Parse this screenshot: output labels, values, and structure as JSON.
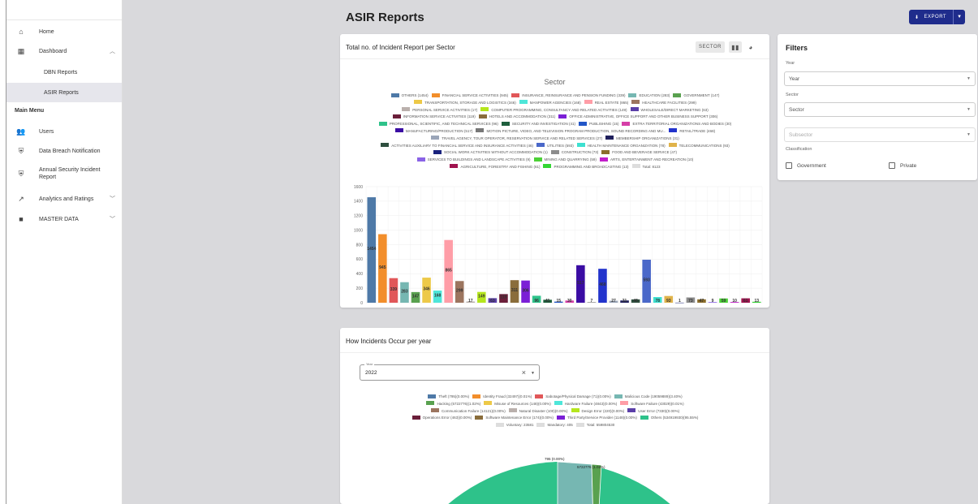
{
  "sidebar": {
    "home": "Home",
    "dashboard": "Dashboard",
    "dbn": "DBN Reports",
    "asir": "ASIR Reports",
    "main_menu": "Main Menu",
    "users": "Users",
    "breach": "Data Breach Notification",
    "annual": "Annual Security Incident Report",
    "analytics": "Analytics and Ratings",
    "master": "MASTER DATA"
  },
  "page": {
    "title": "ASIR Reports",
    "export": "EXPORT"
  },
  "colors": {
    "accent": "#1f2c8c",
    "active_nav": "#e6e6ec"
  },
  "sector_card": {
    "title": "Total no. of Incident Report per Sector",
    "sector_btn": "SECTOR",
    "chart_data": {
      "type": "bar",
      "title": "Sector",
      "ylim": [
        0,
        1600
      ],
      "yticks": [
        0,
        200,
        400,
        600,
        800,
        1000,
        1200,
        1400,
        1600
      ],
      "legend_total": "Total: 8123",
      "series": [
        {
          "name": "OTHERS",
          "value": 1454,
          "color": "#4e79a7"
        },
        {
          "name": "FINANCIAL SERVICE ACTIVITIES",
          "value": 945,
          "color": "#f28e2b"
        },
        {
          "name": "INSURANCE, REINSURANCE AND PENSION FUNDING",
          "value": 339,
          "color": "#e15759"
        },
        {
          "name": "EDUCATION",
          "value": 283,
          "color": "#76b7b2"
        },
        {
          "name": "GOVERNMENT",
          "value": 147,
          "color": "#59a14f"
        },
        {
          "name": "TRANSPORTATION, STORAGE AND LOGISTICS",
          "value": 346,
          "color": "#edc948"
        },
        {
          "name": "MANPOWER AGENCIES",
          "value": 168,
          "color": "#4ee6d9"
        },
        {
          "name": "REAL ESTATE",
          "value": 865,
          "color": "#ff9da7"
        },
        {
          "name": "HEALTHCARE FACILITIES",
          "value": 299,
          "color": "#9c755f"
        },
        {
          "name": "PERSONAL SERVICE ACTIVITIES",
          "value": 17,
          "color": "#bab0ac"
        },
        {
          "name": "COMPUTER PROGRAMMING, CONSULTANCY AND RELATED ACTIVITIES",
          "value": 149,
          "color": "#b5e61d"
        },
        {
          "name": "MANPOWER AGENCIES",
          "value": 63,
          "color": "#5b3fa8"
        },
        {
          "name": "INFORMATION SERVICE ACTIVITIES",
          "value": 119,
          "color": "#6b1f3a"
        },
        {
          "name": "HOTELS AND ACCOMMODATION",
          "value": 311,
          "color": "#8a6d3b"
        },
        {
          "name": "OFFICE ADMINISTRATIVE, OFFICE SUPPORT AND OTHER BUSINESS SUPPORT",
          "value": 306,
          "color": "#7b1fd6"
        },
        {
          "name": "PROFESSIONAL, SCIENTIFIC, AND TECHNICAL SERVICES",
          "value": 96,
          "color": "#2ec28a"
        },
        {
          "name": "SECURITY AND INVESTIGATION",
          "value": 41,
          "color": "#1d5e3c"
        },
        {
          "name": "PUBLISHING",
          "value": 15,
          "color": "#2356c7"
        },
        {
          "name": "EXTRA TERRITORIAL ORGANIZATIONS AND BODIES",
          "value": 30,
          "color": "#d63fa8"
        },
        {
          "name": "MANUFACTURING/PRODUCTION",
          "value": 517,
          "color": "#3a0ca3"
        },
        {
          "name": "MOTION PICTURE, VIDEO, AND TELEVISION PROGRAM PRODUCTION, SOUND RECORDING AND MU...",
          "value": 7,
          "color": "#777777"
        },
        {
          "name": "RETAIL/TRADE",
          "value": 468,
          "color": "#2233cc"
        },
        {
          "name": "TRAVEL AGENCY, TOUR OPERATOR, RESERVATION SERVICE AND RELATED SERVICES",
          "value": 27,
          "color": "#9aa5b8"
        },
        {
          "name": "MEMBERSHIP ORGANIZATIONS",
          "value": 31,
          "color": "#1f1f5c"
        },
        {
          "name": "ACTIVITIES AUXILIARY TO FINANCIAL SERVICE AND INSURANCE ACTIVITIES",
          "value": 46,
          "color": "#2f4f3f"
        },
        {
          "name": "UTILITIES",
          "value": 593,
          "color": "#4a68c9"
        },
        {
          "name": "HEALTH MAINTENANCE ORGANIZATION",
          "value": 78,
          "color": "#3de0d0"
        },
        {
          "name": "TELECOMMUNICATIONS",
          "value": 93,
          "color": "#e0b34a"
        },
        {
          "name": "SOCIAL WORK ACTIVITIES WITHOUT ACCOMMODATION",
          "value": 1,
          "color": "#1a237e"
        },
        {
          "name": "CONSTRUCTION",
          "value": 73,
          "color": "#8c8c8c"
        },
        {
          "name": "FOOD AND BEVERAGE SERVICE",
          "value": 47,
          "color": "#8b6d2b"
        },
        {
          "name": "SERVICES TO BUILDINGS AND LANDSCAPE ACTIVITIES",
          "value": 9,
          "color": "#8a63e6"
        },
        {
          "name": "MINING AND QUARRYING",
          "value": 59,
          "color": "#4cd137"
        },
        {
          "name": "ARTS, ENTERTAINMENT AND RECREATION",
          "value": 10,
          "color": "#c21ec9"
        },
        {
          "name": "AGRICULTURE, FORESTRY AND FISHING",
          "value": 61,
          "color": "#a0144f"
        },
        {
          "name": "PROGRAMMING AND BROADCASTING",
          "value": 13,
          "color": "#33d633"
        }
      ]
    }
  },
  "legend_rows": [
    [
      [
        "OTHERS (1454)",
        "#4e79a7"
      ],
      [
        "FINANCIAL SERVICE ACTIVITIES (945)",
        "#f28e2b"
      ],
      [
        "INSURANCE, REINSURANCE AND PENSION FUNDING (339)",
        "#e15759"
      ],
      [
        "EDUCATION (283)",
        "#76b7b2"
      ],
      [
        "GOVERNMENT (147)",
        "#59a14f"
      ]
    ],
    [
      [
        "TRANSPORTATION, STORAGE AND LOGISTICS (346)",
        "#edc948"
      ],
      [
        "MANPOWER AGENCIES (168)",
        "#4ee6d9"
      ],
      [
        "REAL ESTATE (865)",
        "#ff9da7"
      ],
      [
        "HEALTHCARE FACILITIES (299)",
        "#9c755f"
      ]
    ],
    [
      [
        "PERSONAL SERVICE ACTIVITIES (17)",
        "#bab0ac"
      ],
      [
        "COMPUTER PROGRAMMING, CONSULTANCY AND RELATED ACTIVITIES (149)",
        "#b5e61d"
      ],
      [
        "WHOLESALE/DIRECT MARKETING (63)",
        "#5b3fa8"
      ]
    ],
    [
      [
        "INFORMATION SERVICE ACTIVITIES (119)",
        "#6b1f3a"
      ],
      [
        "HOTELS AND ACCOMMODATION (311)",
        "#8a6d3b"
      ],
      [
        "OFFICE ADMINISTRATIVE, OFFICE SUPPORT AND OTHER BUSINESS SUPPORT (306)",
        "#7b1fd6"
      ]
    ],
    [
      [
        "PROFESSIONAL, SCIENTIFIC, AND TECHNICAL SERVICES (96)",
        "#2ec28a"
      ],
      [
        "SECURITY AND INVESTIGATION (41)",
        "#1d5e3c"
      ],
      [
        "PUBLISHING (15)",
        "#2356c7"
      ],
      [
        "EXTRA TERRITORIAL ORGANIZATIONS AND BODIES (30)",
        "#d63fa8"
      ]
    ],
    [
      [
        "MANUFACTURING/PRODUCTION (517)",
        "#3a0ca3"
      ],
      [
        "MOTION PICTURE, VIDEO, AND TELEVISION PROGRAM PRODUCTION, SOUND RECORDING AND MU...",
        "#777777"
      ],
      [
        "RETAIL/TRADE (468)",
        "#2233cc"
      ]
    ],
    [
      [
        "TRAVEL AGENCY, TOUR OPERATOR, RESERVATION SERVICE AND RELATED SERVICES (27)",
        "#9aa5b8"
      ],
      [
        "MEMBERSHIP ORGANIZATIONS (31)",
        "#1f1f5c"
      ]
    ],
    [
      [
        "ACTIVITIES AUXILIARY TO FINANCIAL SERVICE AND INSURANCE ACTIVITIES (46)",
        "#2f4f3f"
      ],
      [
        "UTILITIES (593)",
        "#4a68c9"
      ],
      [
        "HEALTH MAINTENANCE ORGANIZATION (78)",
        "#3de0d0"
      ],
      [
        "TELECOMMUNICATIONS (93)",
        "#e0b34a"
      ]
    ],
    [
      [
        "SOCIAL WORK ACTIVITIES WITHOUT ACCOMMODATION (1)",
        "#1a237e"
      ],
      [
        "CONSTRUCTION (73)",
        "#8c8c8c"
      ],
      [
        "FOOD AND BEVERAGE SERVICE (47)",
        "#8b6d2b"
      ]
    ],
    [
      [
        "SERVICES TO BUILDINGS AND LANDSCAPE ACTIVITIES (9)",
        "#8a63e6"
      ],
      [
        "MINING AND QUARRYING (59)",
        "#4cd137"
      ],
      [
        "ARTS, ENTERTAINMENT AND RECREATION (10)",
        "#c21ec9"
      ]
    ],
    [
      [
        "AGRICULTURE, FORESTRY AND FISHING (61)",
        "#a0144f"
      ],
      [
        "PROGRAMMING AND BROADCASTING (13)",
        "#33d633"
      ],
      [
        "Total: 8123",
        "#dddddd"
      ]
    ]
  ],
  "filters": {
    "title": "Filters",
    "year_label": "Year",
    "year_value": "Year",
    "sector_label": "Sector",
    "sector_value": "Sector",
    "subsector_value": "Subsector",
    "classification_label": "Classification",
    "government": "Government",
    "private": "Private"
  },
  "incidents_card": {
    "title": "How Incidents Occur per year",
    "year_field_label": "Year",
    "year_value": "2022",
    "legend_rows": [
      [
        [
          "Theft (795)(0.00%)",
          "#4e79a7"
        ],
        [
          "Identity Fraud (32497)(0.01%)",
          "#f28e2b"
        ],
        [
          "Sabotage/Physical Damage (71)(0.00%)",
          "#e15759"
        ],
        [
          "Malicious Code (19059889)(3.40%)",
          "#76b7b2"
        ]
      ],
      [
        [
          "Hacking (5722776)(1.02%)",
          "#59a14f"
        ],
        [
          "Misuse of Resources (148)(0.00%)",
          "#edc948"
        ],
        [
          "Hardware Failure (4843)(0.00%)",
          "#4ee6d9"
        ],
        [
          "Software Failure (43029)(0.01%)",
          "#ff9da7"
        ]
      ],
      [
        [
          "Communication Failure (14121)(0.00%)",
          "#9c755f"
        ],
        [
          "Natural Disaster (100)(0.00%)",
          "#bab0ac"
        ],
        [
          "Design Error (220)(0.00%)",
          "#b5e61d"
        ],
        [
          "User Error (7330)(0.00%)",
          "#5b3fa8"
        ]
      ],
      [
        [
          "Operations Error (463)(0.00%)",
          "#6b1f3a"
        ],
        [
          "Software Maintenance Error (174)(0.00%)",
          "#8a6d3b"
        ],
        [
          "Third Party/Service Provider (1148)(0.00%)",
          "#7b1fd6"
        ],
        [
          "Others (534919930)(95.55%)",
          "#2ec28a"
        ]
      ],
      [
        [
          "Voluntary: 23581",
          "#dddddd"
        ],
        [
          "Mandatory: 405",
          "#dddddd"
        ],
        [
          "Total: 559804530",
          "#dddddd"
        ]
      ]
    ],
    "pie_labels": {
      "theft": "795 (0.00%)",
      "hacking": "5722776 (1.02%)"
    },
    "chart_data": {
      "type": "pie",
      "slices": [
        {
          "name": "Theft",
          "value": 795
        },
        {
          "name": "Identity Fraud",
          "value": 32497
        },
        {
          "name": "Sabotage/Physical Damage",
          "value": 71
        },
        {
          "name": "Malicious Code",
          "value": 19059889
        },
        {
          "name": "Hacking",
          "value": 5722776
        },
        {
          "name": "Misuse of Resources",
          "value": 148
        },
        {
          "name": "Hardware Failure",
          "value": 4843
        },
        {
          "name": "Software Failure",
          "value": 43029
        },
        {
          "name": "Communication Failure",
          "value": 14121
        },
        {
          "name": "Natural Disaster",
          "value": 100
        },
        {
          "name": "Design Error",
          "value": 220
        },
        {
          "name": "User Error",
          "value": 7330
        },
        {
          "name": "Operations Error",
          "value": 463
        },
        {
          "name": "Software Maintenance Error",
          "value": 174
        },
        {
          "name": "Third Party/Service Provider",
          "value": 1148
        },
        {
          "name": "Others",
          "value": 534919930
        }
      ]
    }
  }
}
